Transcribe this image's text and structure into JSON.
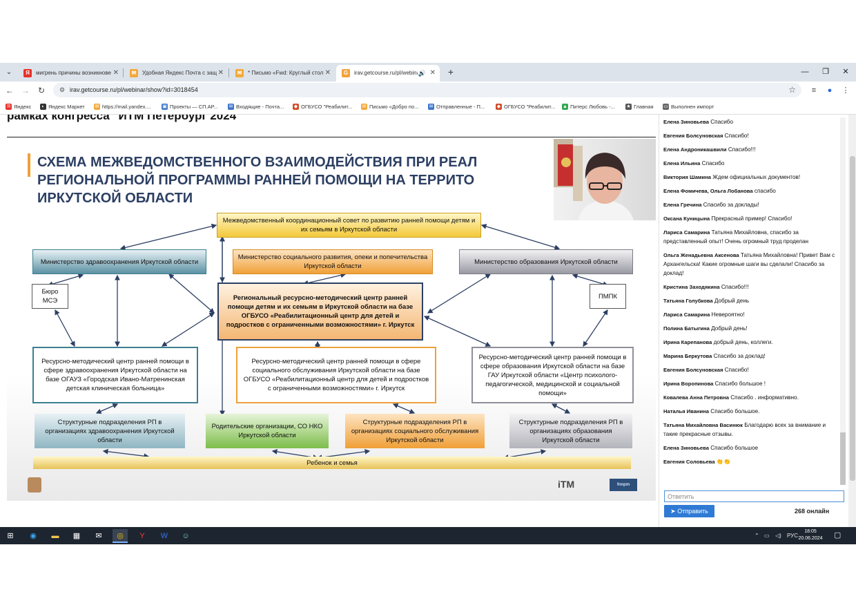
{
  "browser": {
    "tabs": [
      {
        "title": "мигрень причины возникнове",
        "icon": "yandex-icon",
        "color": "#e8312a",
        "glyph": "Я"
      },
      {
        "title": "Удобная Яндекс Почта с защ",
        "icon": "mail-icon",
        "color": "#f3a93a",
        "glyph": "✉"
      },
      {
        "title": "* Письмо «Fwd: Круглый стол",
        "icon": "mail-icon",
        "color": "#f3a93a",
        "glyph": "✉"
      },
      {
        "title": "irav.getcourse.ru/pl/webina",
        "icon": "getcourse-icon",
        "color": "#f2a33a",
        "glyph": "G"
      }
    ],
    "url": "irav.getcourse.ru/pl/webinar/show?id=3018454",
    "bookmarks": [
      {
        "label": "Яндекс",
        "color": "#e8312a",
        "glyph": "Я"
      },
      {
        "label": "Яндекс Маркет",
        "color": "#333333",
        "glyph": "◐"
      },
      {
        "label": "https://mail.yandex....",
        "color": "#f3a93a",
        "glyph": "✉"
      },
      {
        "label": "Проекты — СП.АР...",
        "color": "#3b73c9",
        "glyph": "▣"
      },
      {
        "label": "Входящие - Почта...",
        "color": "#3b73c9",
        "glyph": "✉"
      },
      {
        "label": "ОГБУСО \"Реабилит...",
        "color": "#d04d2a",
        "glyph": "◆"
      },
      {
        "label": "Письмо «Добро по...",
        "color": "#f3a93a",
        "glyph": "✉"
      },
      {
        "label": "Отправленные - П...",
        "color": "#3b73c9",
        "glyph": "✉"
      },
      {
        "label": "ОГБУСО \"Реабилит...",
        "color": "#d04d2a",
        "glyph": "◆"
      },
      {
        "label": "Питерс Любовь -...",
        "color": "#34a853",
        "glyph": "▲"
      },
      {
        "label": "Главная",
        "color": "#555555",
        "glyph": "★"
      },
      {
        "label": "Выполнен импорт",
        "color": "#666666",
        "glyph": "▭"
      }
    ]
  },
  "webinar": {
    "title": "рамках конгресса \"ИТМ Петербург 2024\""
  },
  "slide": {
    "heading": "СХЕМА МЕЖВЕДОМСТВЕННОГО ВЗАИМОДЕЙСТВИЯ ПРИ РЕАЛ\nРЕГИОНАЛЬНОЙ ПРОГРАММЫ РАННЕЙ ПОМОЩИ НА ТЕРРИТО\nИРКУТСКОЙ ОБЛАСТИ",
    "council": "Межведомственный координационный совет по развитию ранней помощи детям и их семьям в Иркутской области",
    "min_health": "Министерство здравоохранения Иркутской области",
    "min_social": "Министерство социального развития, опеки и попечительства Иркутской области",
    "min_edu": "Министерство образования Иркутской области",
    "bureau": "Бюро МСЭ",
    "pmpk": "ПМПК",
    "regional_center": "Региональный ресурсно-методический центр ранней помощи детям и их семьям в Иркутской области на базе ОГБУСО «Реабилитационный центр для детей и подростков с ограниченными возможностями» г. Иркутск",
    "center_health": "Ресурсно-методический центр ранней помощи в сфере здравоохранения Иркутской области на базе ОГАУЗ «Городская Ивано-Матренинская детская клиническая больница»",
    "center_social": "Ресурсно-методический центр ранней помощи в сфере социального обслуживания Иркутской области на базе ОГБУСО «Реабилитационный центр для детей и подростков с ограниченными возможностями» г. Иркутск",
    "center_edu": "Ресурсно-методический центр ранней помощи в сфере образования Иркутской области на базе ГАУ Иркутской области «Центр психолого-педагогической, медицинской и социальной помощи»",
    "units_health": "Структурные подразделения РП в организациях здравоохранения Иркутской области",
    "parents": "Родительские организации, СО НКО Иркутской области",
    "units_social": "Структурные подразделения РП в организациях социального обслуживания Иркутской области",
    "units_edu": "Структурные подразделения РП в организациях образования Иркутской области",
    "family": "Ребенок и семья",
    "logo_itm": "iTM",
    "logo_right": "fnnpm",
    "colors": {
      "heading": "#2c3f63",
      "teal": "#3b7f8f",
      "orange": "#f0a038",
      "gray": "#8f8f99",
      "green": "#7cbd4a",
      "yellow": "#f3c93a"
    }
  },
  "chat": {
    "messages": [
      {
        "author": "Елена Зиновьева",
        "text": "Спасибо"
      },
      {
        "author": "Евгения Болсуновская",
        "text": "Спасибо!"
      },
      {
        "author": "Елена Андроникашвили",
        "text": "Спасибо!!!"
      },
      {
        "author": "Елена Ильина",
        "text": "Спасибо"
      },
      {
        "author": "Виктория Шамина",
        "text": "Ждем официальных документов!"
      },
      {
        "author": "Елена Фомичева, Ольга Лобанова",
        "text": "спасибо"
      },
      {
        "author": "Елена Гречина",
        "text": "Спасибо за доклады!"
      },
      {
        "author": "Оксана Куницына",
        "text": "Прекрасный пример! Спасибо!"
      },
      {
        "author": "Лариса Самарина",
        "text": "Татьяна Михайловна, спасибо за представленный опыт! Очень огромный труд проделан"
      },
      {
        "author": "Ольга Женадьевна Аксенова",
        "text": "Татьяна Михайловна! Привет Вам с Архангельска! Какие огромные шаги вы сделали! Спасибо за доклад!"
      },
      {
        "author": "Кристина Заходякина",
        "text": "Спасибо!!!"
      },
      {
        "author": "Татьяна Голубкова",
        "text": "Добрый день"
      },
      {
        "author": "Лариса Самарина",
        "text": "Невероятно!"
      },
      {
        "author": "Полина Батыгина",
        "text": "Добрый день!"
      },
      {
        "author": "Ирина Карепанова",
        "text": "добрый день, коллеги."
      },
      {
        "author": "Марина Беркутова",
        "text": "Спасибо за доклад!"
      },
      {
        "author": "Евгения Болсуновская",
        "text": "Спасибо!"
      },
      {
        "author": "Ирина Воропинова",
        "text": "Спасибо большое !"
      },
      {
        "author": "Ковалева Анна Петровна",
        "text": "Спасибо . информативно."
      },
      {
        "author": "Наталья Иванина",
        "text": "Спасибо большое."
      },
      {
        "author": "Татьяна Михайловна Васинюк",
        "text": "Благодарю всех за внимание и такие прекрасные отзывы."
      },
      {
        "author": "Елена Зиновьева",
        "text": "Спасибо большое"
      },
      {
        "author": "Евгения Соловьева",
        "text": "👏👏"
      }
    ],
    "reply_placeholder": "Ответить",
    "send_label": "Отправить",
    "online": "268 онлайн"
  },
  "taskbar": {
    "lang": "РУС",
    "time": "18:05",
    "date": "20.06.2024"
  }
}
